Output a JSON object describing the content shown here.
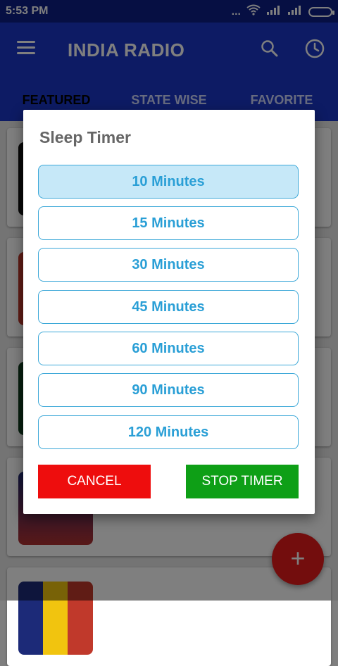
{
  "status_bar": {
    "time": "5:53 PM",
    "dots": "..."
  },
  "app": {
    "title": "INDIA RADIO",
    "tabs": [
      "FEATURED",
      "STATE WISE",
      "FAVORITE"
    ],
    "fab_symbol": "+"
  },
  "dialog": {
    "title": "Sleep Timer",
    "options": [
      "10 Minutes",
      "15 Minutes",
      "30 Minutes",
      "45 Minutes",
      "60 Minutes",
      "90 Minutes",
      "120 Minutes"
    ],
    "selected_option": "10 Minutes",
    "cancel_label": "CANCEL",
    "stop_label": "STOP TIMER"
  },
  "colors": {
    "primary": "#1a37c9",
    "status_bar": "#0c1f87",
    "option_text": "#2a9fd6",
    "option_selected_bg": "#c6e8f8",
    "cancel": "#ee0d0d",
    "stop": "#0e9f16",
    "fab": "#e61b1b"
  },
  "icons": {
    "menu": "hamburger-menu-icon",
    "search": "search-icon",
    "timer": "clock-icon",
    "add": "plus-icon",
    "wifi": "wifi-icon",
    "signal": "signal-icon",
    "battery": "battery-icon"
  }
}
